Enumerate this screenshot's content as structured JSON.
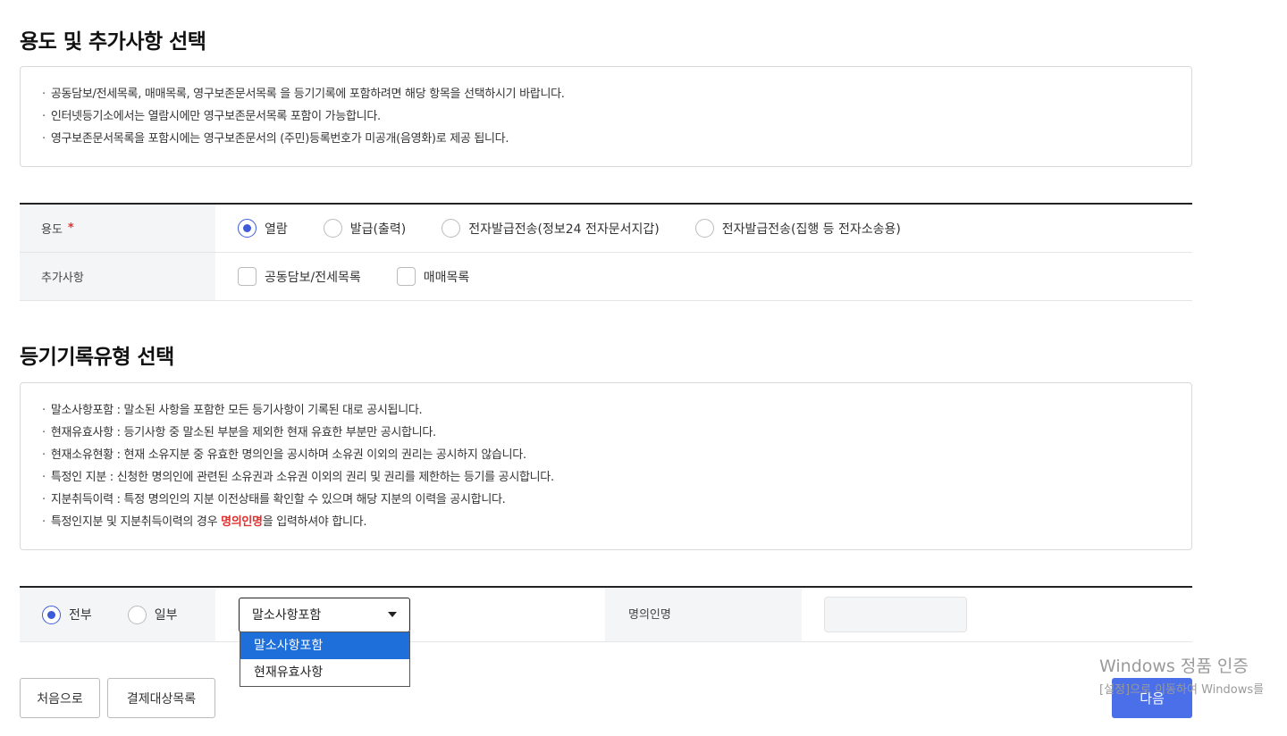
{
  "purpose_section": {
    "title": "용도 및 추가사항 선택",
    "notices": [
      "공동담보/전세목록, 매매목록, 영구보존문서목록 을 등기기록에 포함하려면 해당 항목을 선택하시기 바랍니다.",
      "인터넷등기소에서는 열람시에만 영구보존문서목록 포함이 가능합니다.",
      "영구보존문서목록을 포함시에는 영구보존문서의 (주민)등록번호가 미공개(음영화)로 제공 됩니다."
    ],
    "purpose_label": "용도",
    "required_mark": "*",
    "purpose_options": [
      "열람",
      "발급(출력)",
      "전자발급전송(정보24 전자문서지갑)",
      "전자발급전송(집행 등 전자소송용)"
    ],
    "purpose_selected": "열람",
    "extras_label": "추가사항",
    "extras_options": [
      "공동담보/전세목록",
      "매매목록"
    ]
  },
  "record_type_section": {
    "title": "등기기록유형 선택",
    "notices": [
      "말소사항포함 : 말소된 사항을 포함한 모든 등기사항이 기록된 대로 공시됩니다.",
      "현재유효사항 : 등기사항 중 말소된 부분을 제외한 현재 유효한 부분만 공시합니다.",
      "현재소유현황 : 현재 소유지분 중 유효한 명의인을 공시하며 소유권 이외의 권리는 공시하지 않습니다.",
      "특정인 지분 : 신청한 명의인에 관련된 소유권과 소유권 이외의 권리 및 권리를 제한하는 등기를 공시합니다.",
      "지분취득이력 : 특정 명의인의 지분 이전상태를 확인할 수 있으며 해당 지분의 이력을 공시합니다."
    ],
    "last_notice_prefix": "특정인지분 및 지분취득이력의 경우 ",
    "last_notice_highlight": "명의인명",
    "last_notice_suffix": "을 입력하셔야 합니다.",
    "scope_options": [
      "전부",
      "일부"
    ],
    "scope_selected": "전부",
    "select_value": "말소사항포함",
    "dropdown_options": [
      "말소사항포함",
      "현재유효사항"
    ],
    "owner_label": "명의인명",
    "owner_value": ""
  },
  "buttons": {
    "home": "처음으로",
    "payment_list": "결제대상목록",
    "next": "다음"
  },
  "watermark": {
    "line1": "Windows 정품 인증",
    "line2": "[설정]으로 이동하여 Windows를"
  },
  "colors": {
    "accent": "#3e5bd8",
    "primary_button": "#4a6fe8",
    "required": "#e03131",
    "dropdown_highlight": "#1e6fd9"
  }
}
